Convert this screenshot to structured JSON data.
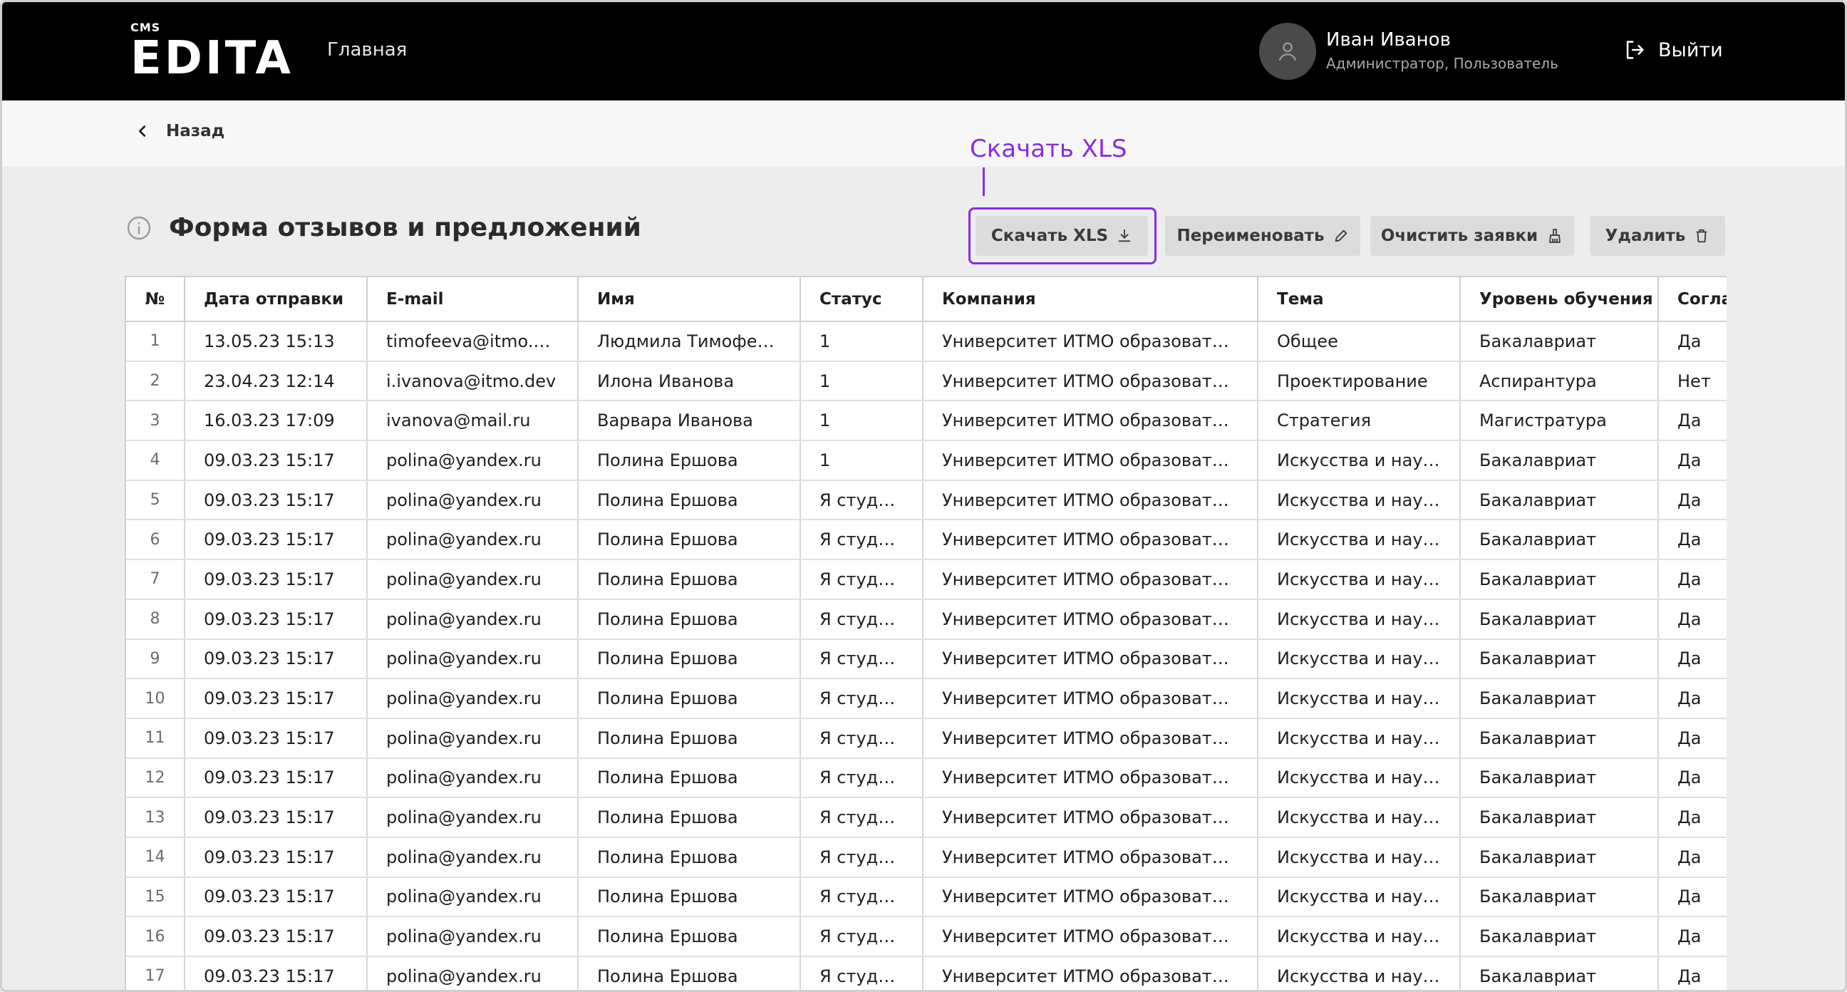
{
  "header": {
    "logo_small": "CMS",
    "logo_main": "EDITA",
    "nav_home": "Главная",
    "user_name": "Иван Иванов",
    "user_role": "Администратор, Пользователь",
    "logout_label": "Выйти"
  },
  "subheader": {
    "back_label": "Назад"
  },
  "annotation": {
    "label": "Скачать XLS",
    "color": "#8a2be2"
  },
  "page": {
    "title": "Форма отзывов и предложений"
  },
  "toolbar": {
    "download_label": "Скачать XLS",
    "rename_label": "Переименовать",
    "clear_label": "Очистить заявки",
    "delete_label": "Удалить"
  },
  "table": {
    "columns": [
      "№",
      "Дата отправки",
      "E-mail",
      "Имя",
      "Статус",
      "Компания",
      "Тема",
      "Уровень обучения",
      "Согла"
    ],
    "rows": [
      [
        "1",
        "13.05.23 15:13",
        "timofeeva@itmo.dev",
        "Людмила Тимофеева",
        "1",
        "Университет ИТМО образовател...",
        "Общее",
        "Бакалавриат",
        "Да"
      ],
      [
        "2",
        "23.04.23 12:14",
        "i.ivanova@itmo.dev",
        "Илона Иванова",
        "1",
        "Университет ИТМО образовател...",
        "Проектирование",
        "Аспирантура",
        "Нет"
      ],
      [
        "3",
        "16.03.23 17:09",
        "ivanova@mail.ru",
        "Варвара Иванова",
        "1",
        "Университет ИТМО образовател...",
        "Стратегия",
        "Магистратура",
        "Да"
      ],
      [
        "4",
        "09.03.23 15:17",
        "polina@yandex.ru",
        "Полина Ершова",
        "1",
        "Университет ИТМО образовател...",
        "Искусства и науки",
        "Бакалавриат",
        "Да"
      ],
      [
        "5",
        "09.03.23 15:17",
        "polina@yandex.ru",
        "Полина Ершова",
        "Я студент",
        "Университет ИТМО образовател...",
        "Искусства и науки",
        "Бакалавриат",
        "Да"
      ],
      [
        "6",
        "09.03.23 15:17",
        "polina@yandex.ru",
        "Полина Ершова",
        "Я студент",
        "Университет ИТМО образовател...",
        "Искусства и науки",
        "Бакалавриат",
        "Да"
      ],
      [
        "7",
        "09.03.23 15:17",
        "polina@yandex.ru",
        "Полина Ершова",
        "Я студент",
        "Университет ИТМО образовател...",
        "Искусства и науки",
        "Бакалавриат",
        "Да"
      ],
      [
        "8",
        "09.03.23 15:17",
        "polina@yandex.ru",
        "Полина Ершова",
        "Я студент",
        "Университет ИТМО образовател...",
        "Искусства и науки",
        "Бакалавриат",
        "Да"
      ],
      [
        "9",
        "09.03.23 15:17",
        "polina@yandex.ru",
        "Полина Ершова",
        "Я студент",
        "Университет ИТМО образовател...",
        "Искусства и науки",
        "Бакалавриат",
        "Да"
      ],
      [
        "10",
        "09.03.23 15:17",
        "polina@yandex.ru",
        "Полина Ершова",
        "Я студент",
        "Университет ИТМО образовател...",
        "Искусства и науки",
        "Бакалавриат",
        "Да"
      ],
      [
        "11",
        "09.03.23 15:17",
        "polina@yandex.ru",
        "Полина Ершова",
        "Я студент",
        "Университет ИТМО образовател...",
        "Искусства и науки",
        "Бакалавриат",
        "Да"
      ],
      [
        "12",
        "09.03.23 15:17",
        "polina@yandex.ru",
        "Полина Ершова",
        "Я студент",
        "Университет ИТМО образовател...",
        "Искусства и науки",
        "Бакалавриат",
        "Да"
      ],
      [
        "13",
        "09.03.23 15:17",
        "polina@yandex.ru",
        "Полина Ершова",
        "Я студент",
        "Университет ИТМО образовател...",
        "Искусства и науки",
        "Бакалавриат",
        "Да"
      ],
      [
        "14",
        "09.03.23 15:17",
        "polina@yandex.ru",
        "Полина Ершова",
        "Я студент",
        "Университет ИТМО образовател...",
        "Искусства и науки",
        "Бакалавриат",
        "Да"
      ],
      [
        "15",
        "09.03.23 15:17",
        "polina@yandex.ru",
        "Полина Ершова",
        "Я студент",
        "Университет ИТМО образовател...",
        "Искусства и науки",
        "Бакалавриат",
        "Да"
      ],
      [
        "16",
        "09.03.23 15:17",
        "polina@yandex.ru",
        "Полина Ершова",
        "Я студент",
        "Университет ИТМО образовател...",
        "Искусства и науки",
        "Бакалавриат",
        "Да"
      ],
      [
        "17",
        "09.03.23 15:17",
        "polina@yandex.ru",
        "Полина Ершова",
        "Я студент",
        "Университет ИТМО образовател...",
        "Искусства и науки",
        "Бакалавриат",
        "Да"
      ]
    ]
  }
}
